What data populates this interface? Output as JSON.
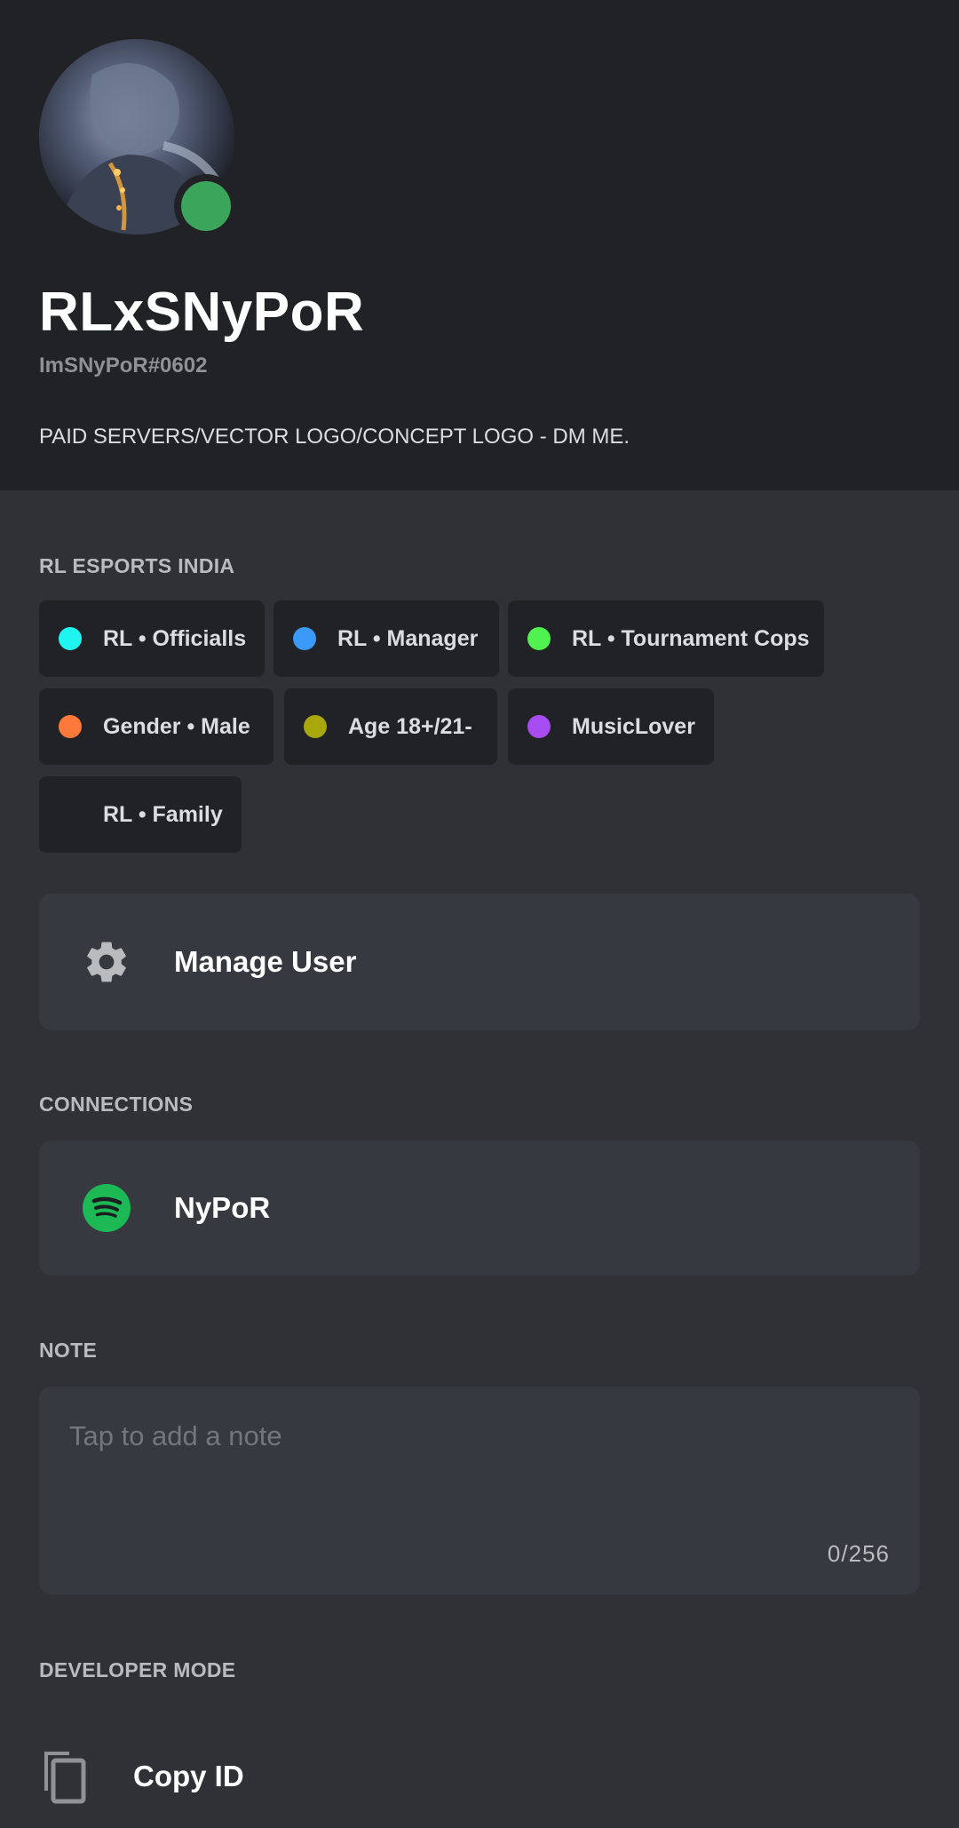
{
  "profile": {
    "display_name": "RLxSNyPoR",
    "user_tag": "ImSNyPoR#0602",
    "bio": "PAID SERVERS/VECTOR LOGO/CONCEPT LOGO - DM ME.",
    "status": "online",
    "status_color": "#3ba55c"
  },
  "server": {
    "name": "RL ESPORTS INDIA",
    "roles": [
      {
        "label": "RL • Officialls",
        "color": "#1ff5f0"
      },
      {
        "label": "RL • Manager",
        "color": "#3a9af5"
      },
      {
        "label": "RL • Tournament Cops",
        "color": "#4ff24f"
      },
      {
        "label": "Gender • Male",
        "color": "#ff7a3a"
      },
      {
        "label": "Age 18+/21-",
        "color": "#a8a80c"
      },
      {
        "label": "MusicLover",
        "color": "#a64cf0"
      },
      {
        "label": "RL • Family",
        "color": "#202225"
      }
    ]
  },
  "manage_user": {
    "label": "Manage User",
    "icon": "gear-icon"
  },
  "connections": {
    "title": "CONNECTIONS",
    "items": [
      {
        "service": "spotify",
        "icon": "spotify-icon",
        "name": "NyPoR",
        "color": "#1db954"
      }
    ]
  },
  "note": {
    "title": "NOTE",
    "placeholder": "Tap to add a note",
    "counter": "0/256"
  },
  "developer_mode": {
    "title": "DEVELOPER MODE",
    "copy_id_label": "Copy ID",
    "icon": "copy-icon"
  },
  "colors": {
    "header_bg": "#202225",
    "body_bg": "#2f3136",
    "card_bg": "#36393f"
  }
}
